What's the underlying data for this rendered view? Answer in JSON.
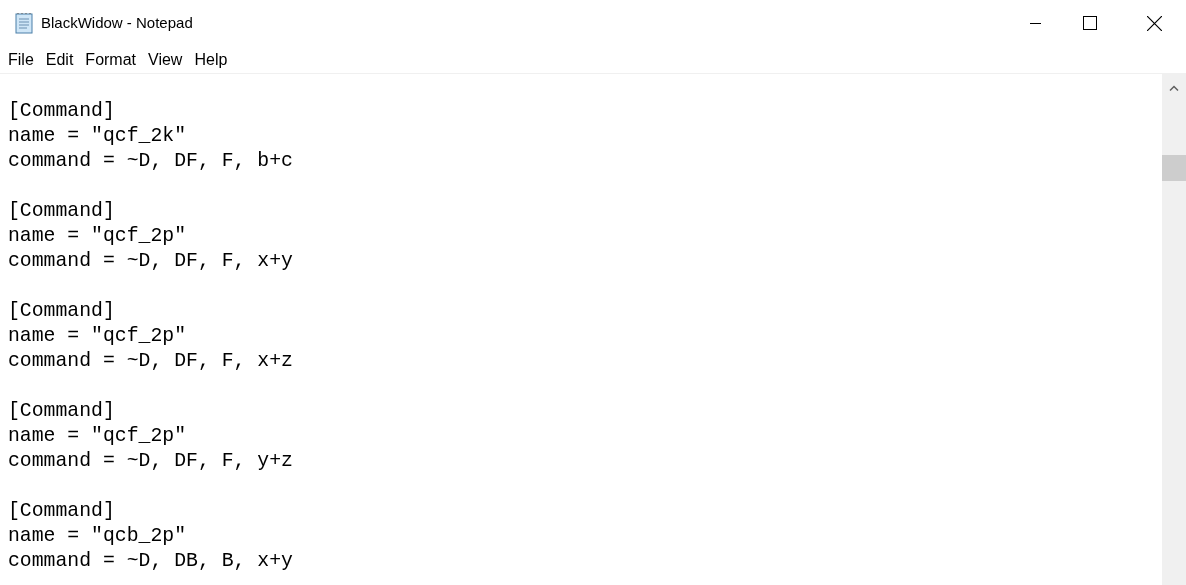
{
  "window": {
    "title": "BlackWidow - Notepad"
  },
  "menu": [
    "File",
    "Edit",
    "Format",
    "View",
    "Help"
  ],
  "blocks": [
    {
      "lines": [
        "[Command]",
        "name = \"qcf_2k\"",
        "command = ~D, DF, F, b+c"
      ]
    },
    {
      "lines": [
        "[Command]",
        "name = \"qcf_2p\"",
        "command = ~D, DF, F, x+y"
      ]
    },
    {
      "lines": [
        "[Command]",
        "name = \"qcf_2p\"",
        "command = ~D, DF, F, x+z"
      ]
    },
    {
      "lines": [
        "[Command]",
        "name = \"qcf_2p\"",
        "command = ~D, DF, F, y+z"
      ]
    },
    {
      "lines": [
        "[Command]",
        "name = \"qcb_2p\"",
        "command = ~D, DB, B, x+y"
      ]
    }
  ]
}
